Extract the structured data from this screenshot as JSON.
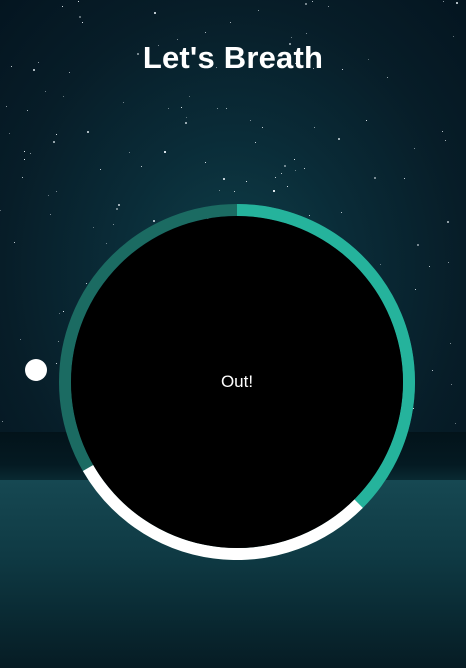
{
  "app": {
    "title": "Let's Breath"
  },
  "breathing": {
    "instruction": "Out!",
    "progress_fraction": 0.5
  },
  "colors": {
    "ring_inactive": "#1b6b62",
    "ring_active": "#25b39c",
    "ring_phase": "#ffffff",
    "circle_fill": "#000000",
    "pointer": "#ffffff"
  }
}
